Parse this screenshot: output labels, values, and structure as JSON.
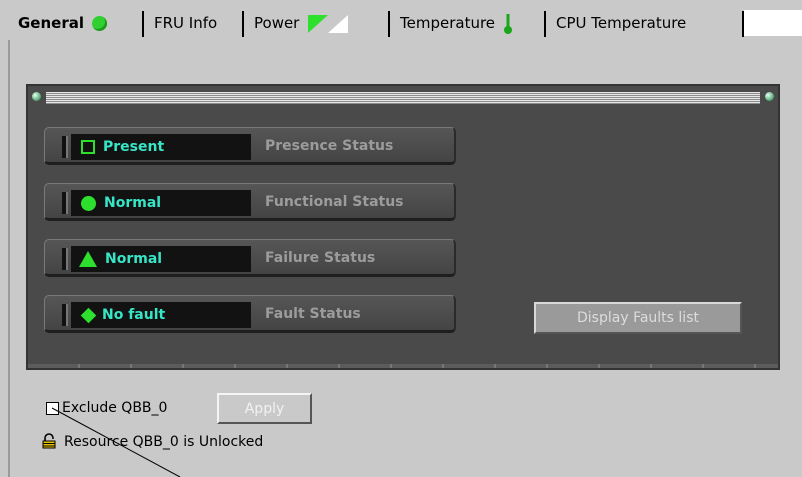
{
  "tabs": [
    {
      "label": "General",
      "icon": "green-status-dot-icon",
      "selected": true
    },
    {
      "label": "FRU Info",
      "icon": null,
      "selected": false
    },
    {
      "label": "Power",
      "icon": "power-triangle-icon",
      "selected": false
    },
    {
      "label": "Temperature",
      "icon": "thermometer-icon",
      "selected": false
    },
    {
      "label": "CPU Temperature",
      "icon": null,
      "selected": false
    }
  ],
  "status_rows": [
    {
      "value": "Present",
      "label": "Presence Status",
      "icon": "square-outline-icon"
    },
    {
      "value": "Normal",
      "label": "Functional Status",
      "icon": "circle-icon"
    },
    {
      "value": "Normal",
      "label": "Failure Status",
      "icon": "triangle-icon"
    },
    {
      "value": "No fault",
      "label": "Fault Status",
      "icon": "diamond-icon"
    }
  ],
  "faults_button": "Display Faults list",
  "exclude": {
    "label": "Exclude QBB_0",
    "checked": false
  },
  "apply_button": "Apply",
  "lock_status": "Resource QBB_0 is Unlocked",
  "colors": {
    "status_value": "#36e6c7",
    "status_icon": "#2ee02e",
    "panel": "#4a4a4a",
    "background": "#c9c9c9"
  }
}
